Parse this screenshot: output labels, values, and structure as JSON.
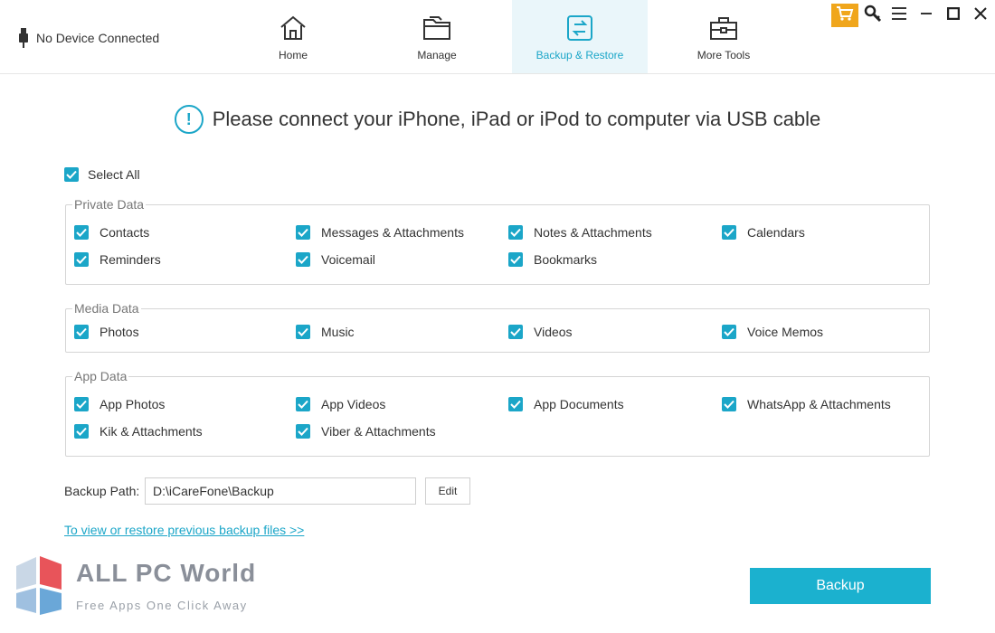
{
  "header": {
    "device_status": "No Device Connected",
    "tabs": [
      {
        "label": "Home",
        "icon": "home-icon",
        "active": false
      },
      {
        "label": "Manage",
        "icon": "folder-icon",
        "active": false
      },
      {
        "label": "Backup & Restore",
        "icon": "backup-restore-icon",
        "active": true
      },
      {
        "label": "More Tools",
        "icon": "toolbox-icon",
        "active": false
      }
    ],
    "window_controls": [
      "cart-icon",
      "key-icon",
      "menu-icon",
      "minimize-icon",
      "maximize-icon",
      "close-icon"
    ]
  },
  "main": {
    "message": "Please connect your iPhone, iPad or iPod to computer via USB cable",
    "select_all": {
      "label": "Select All",
      "checked": true
    },
    "groups": [
      {
        "title": "Private Data",
        "items": [
          {
            "label": "Contacts",
            "checked": true
          },
          {
            "label": "Messages & Attachments",
            "checked": true
          },
          {
            "label": "Notes & Attachments",
            "checked": true
          },
          {
            "label": "Calendars",
            "checked": true
          },
          {
            "label": "Reminders",
            "checked": true
          },
          {
            "label": "Voicemail",
            "checked": true
          },
          {
            "label": "Bookmarks",
            "checked": true
          }
        ]
      },
      {
        "title": "Media Data",
        "items": [
          {
            "label": "Photos",
            "checked": true
          },
          {
            "label": "Music",
            "checked": true
          },
          {
            "label": "Videos",
            "checked": true
          },
          {
            "label": "Voice Memos",
            "checked": true
          }
        ]
      },
      {
        "title": "App Data",
        "items": [
          {
            "label": "App Photos",
            "checked": true
          },
          {
            "label": "App Videos",
            "checked": true
          },
          {
            "label": "App Documents",
            "checked": true
          },
          {
            "label": "WhatsApp & Attachments",
            "checked": true
          },
          {
            "label": "Kik & Attachments",
            "checked": true
          },
          {
            "label": "Viber & Attachments",
            "checked": true
          }
        ]
      }
    ],
    "backup_path": {
      "label": "Backup Path:",
      "value": "D:\\iCareFone\\Backup",
      "edit_label": "Edit"
    },
    "view_link": "To view or restore previous backup files >>",
    "backup_button": "Backup"
  },
  "watermark": {
    "title": "ALL PC World",
    "subtitle": "Free Apps One Click Away"
  },
  "colors": {
    "accent": "#1ba6c8",
    "button": "#1bb1cf",
    "cart": "#f0a61c",
    "active_tab_bg": "#eaf6fa"
  }
}
